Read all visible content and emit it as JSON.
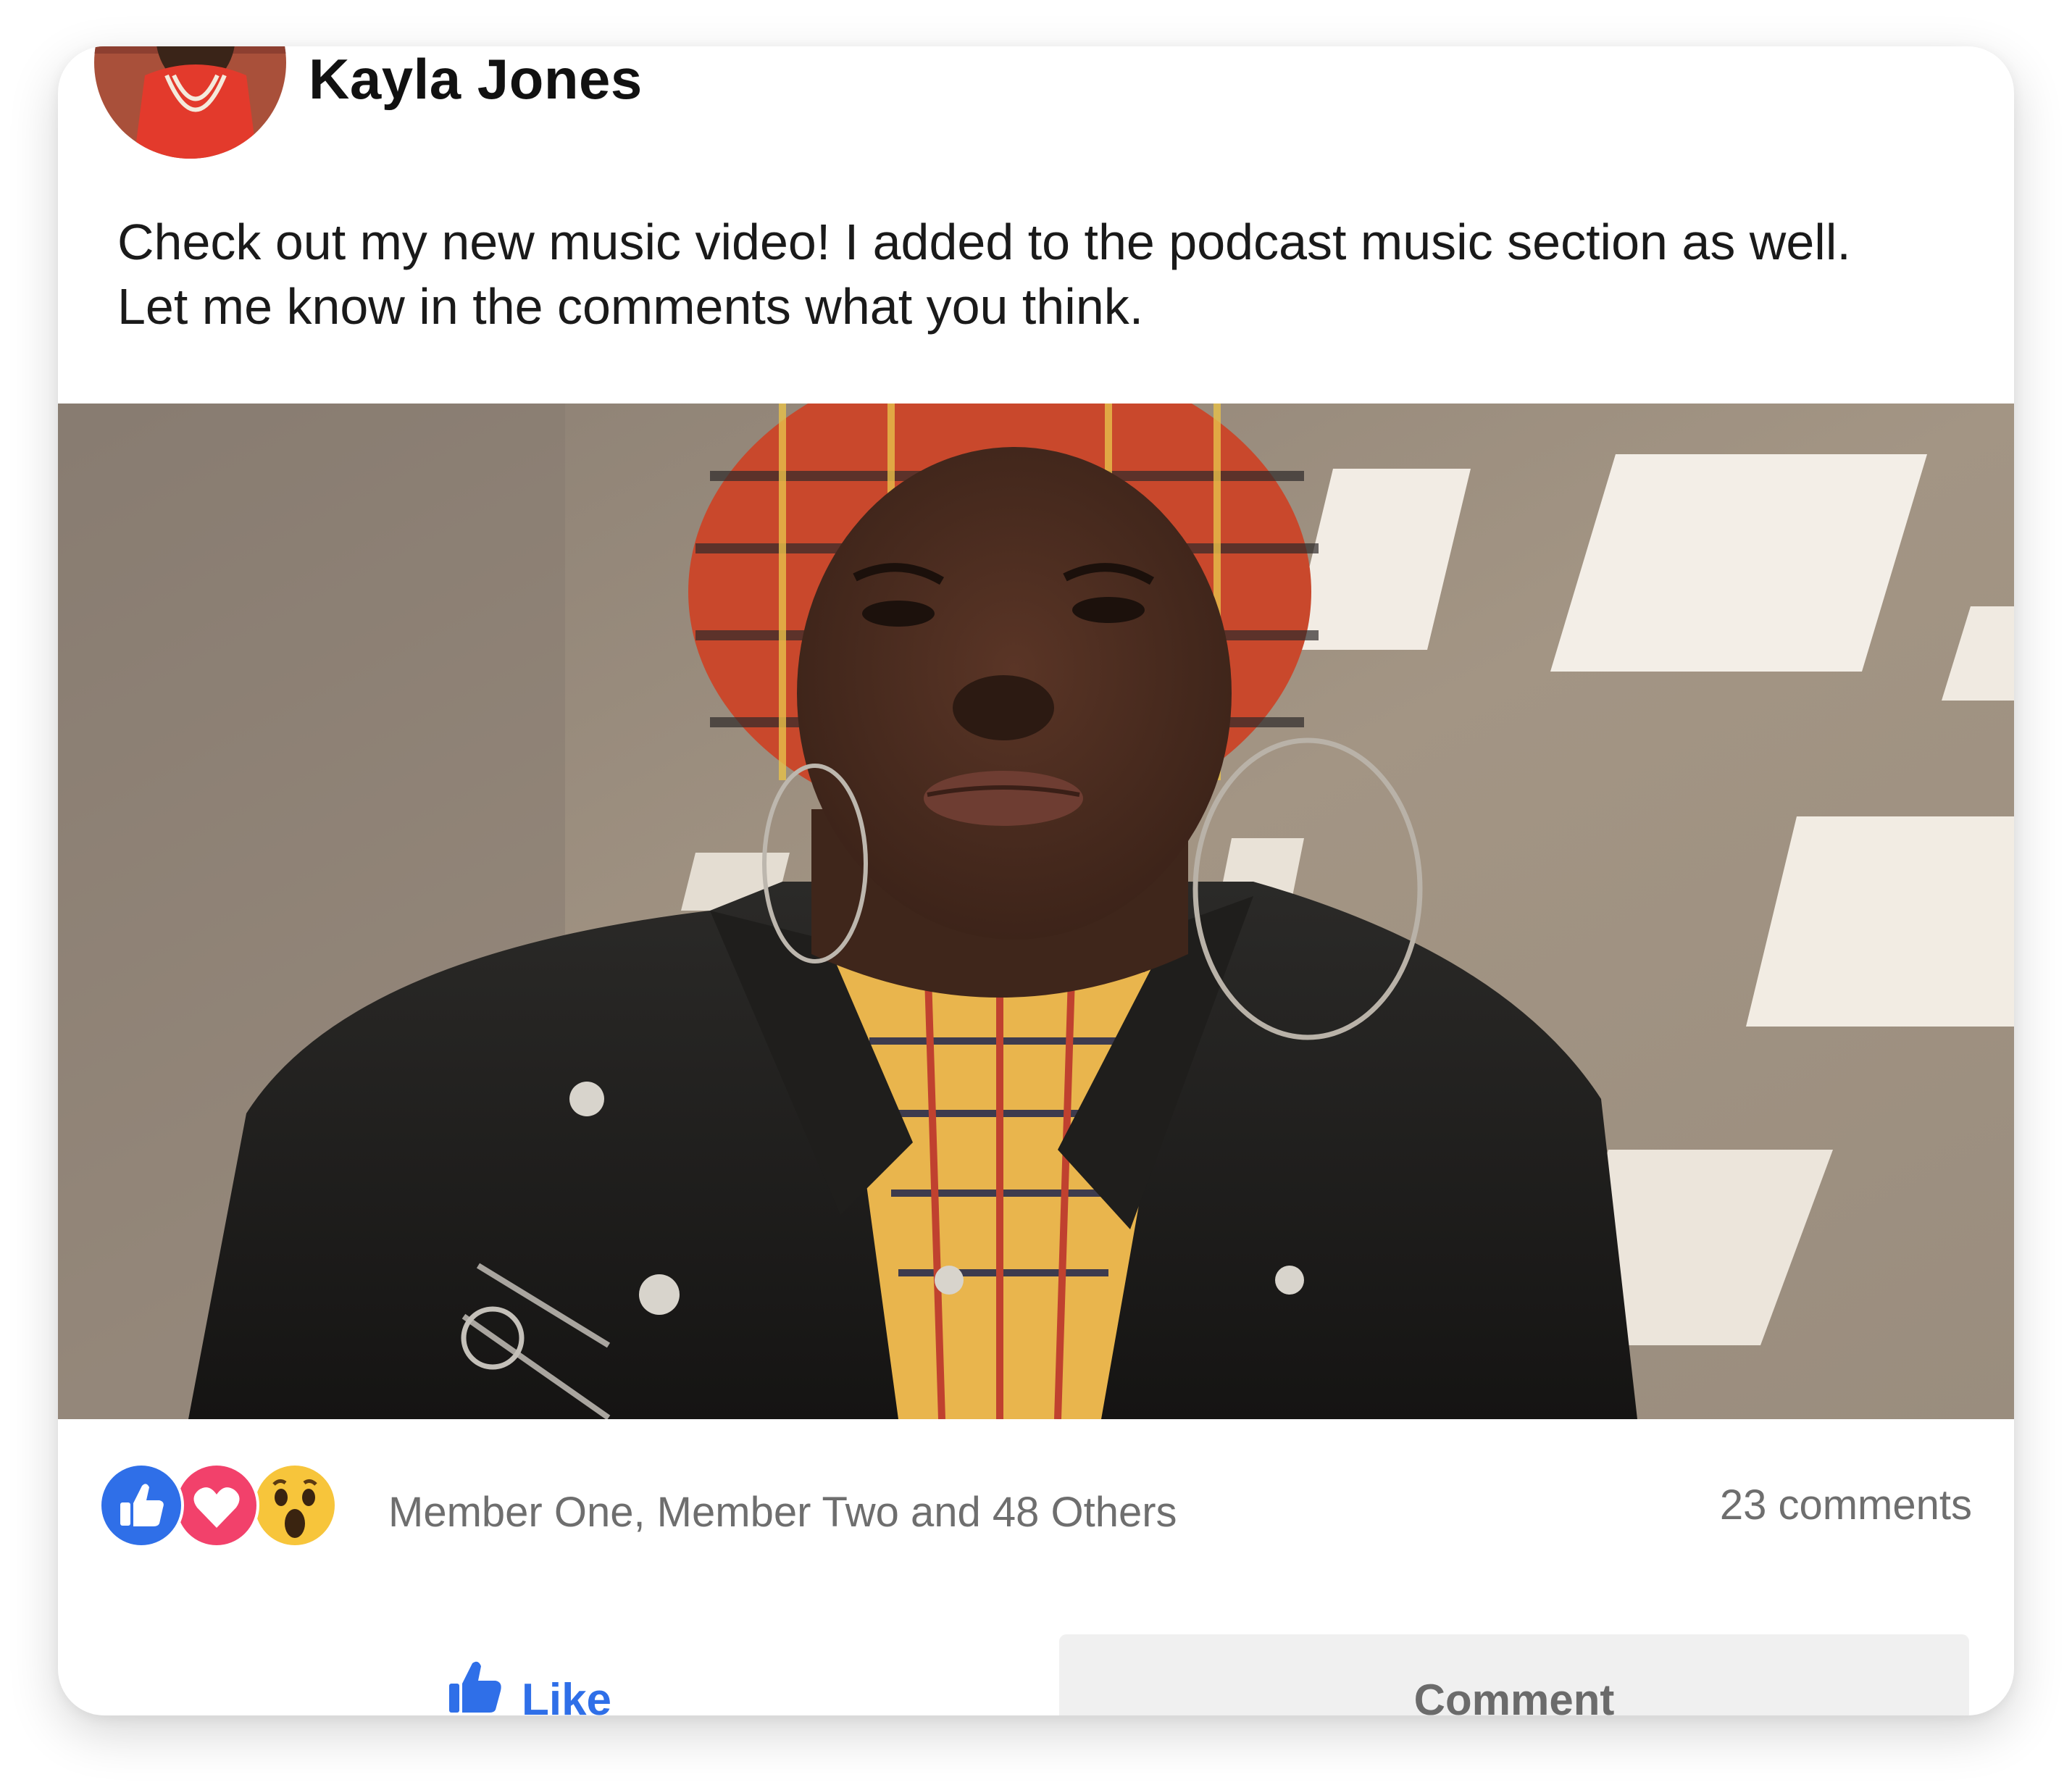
{
  "post": {
    "author": {
      "name": "Kayla Jones",
      "avatar": "avatar-photo"
    },
    "text": "Check out my new music video! I added to the podcast music section as well. Let me know in the comments what you think.",
    "media": "video-thumbnail"
  },
  "reactions": {
    "icons": [
      "thumbs-up-icon",
      "heart-icon",
      "wow-face-icon"
    ],
    "liked_by": "Member One, Member Two and 48 Others",
    "comments": "23 comments"
  },
  "actions": {
    "like_label": "Like",
    "comment_label": "Comment"
  },
  "colors": {
    "like_blue": "#2f6fe8",
    "heart_pink": "#f2416b",
    "wow_yellow": "#f7c53b",
    "muted_text": "#6e6e6e",
    "comment_bg": "#f0f0f0"
  }
}
